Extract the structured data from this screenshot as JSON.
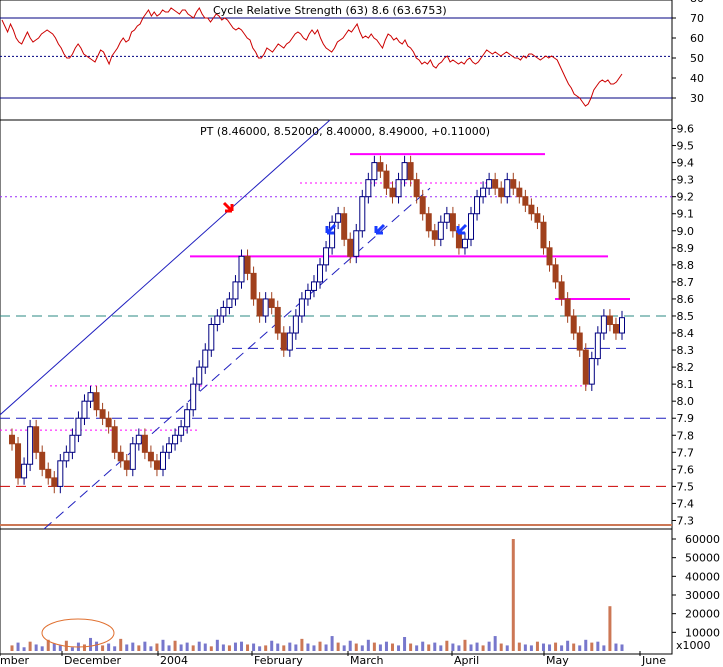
{
  "chart_data": [
    {
      "type": "line",
      "panel": "indicator",
      "title": "Cycle Relative Strength (63) 8.6 (63.6753)",
      "ylim": [
        20,
        80
      ],
      "y_ticks": [
        30,
        40,
        50,
        60,
        70,
        80
      ],
      "reference_lines": [
        {
          "value": 70,
          "color": "#000080",
          "style": "solid"
        },
        {
          "value": 50.8,
          "color": "#000080",
          "style": "dotted"
        },
        {
          "value": 30,
          "color": "#000080",
          "style": "solid"
        }
      ],
      "series": [
        {
          "color": "#cc0000",
          "values": [
            69,
            66,
            63,
            67,
            64,
            60,
            58,
            57,
            60,
            63,
            60,
            58,
            59,
            60,
            62,
            63,
            64,
            63,
            62,
            60,
            57,
            55,
            52,
            50,
            50,
            52,
            55,
            57,
            55,
            52,
            51,
            50,
            49,
            48,
            51,
            54,
            53,
            50,
            47,
            51,
            53,
            55,
            58,
            60,
            58,
            59,
            63,
            64,
            66,
            67,
            70,
            72,
            74,
            71,
            73,
            71,
            72,
            74,
            73,
            73,
            75,
            74,
            73,
            72,
            74,
            74,
            72,
            71,
            70,
            73,
            75,
            72,
            70,
            70,
            68,
            70,
            72,
            71,
            69,
            70,
            69,
            67,
            65,
            64,
            65,
            64,
            62,
            60,
            59,
            55,
            53,
            50,
            50,
            52,
            55,
            54,
            53,
            55,
            57,
            56,
            55,
            57,
            58,
            60,
            62,
            63,
            62,
            60,
            59,
            62,
            64,
            62,
            64,
            60,
            57,
            55,
            54,
            53,
            55,
            58,
            59,
            60,
            62,
            64,
            63,
            65,
            67,
            63,
            60,
            61,
            60,
            62,
            60,
            59,
            57,
            55,
            59,
            62,
            61,
            59,
            60,
            58,
            57,
            59,
            56,
            55,
            53,
            50,
            49,
            47,
            48,
            47,
            49,
            46,
            45,
            47,
            48,
            50,
            51,
            48,
            49,
            48,
            47,
            48,
            47,
            49,
            50,
            48,
            47,
            48,
            50,
            52,
            54,
            53,
            52,
            53,
            52,
            51,
            52,
            53,
            52,
            51,
            50,
            50,
            49,
            51,
            50,
            52,
            52,
            51,
            50,
            49,
            50,
            51,
            50,
            51,
            50,
            49,
            46,
            43,
            40,
            37,
            35,
            32,
            31,
            30,
            28,
            26,
            27,
            30,
            34,
            36,
            38,
            39,
            38,
            39,
            37,
            37,
            38,
            40,
            42
          ]
        }
      ],
      "last_value": 63.6753
    },
    {
      "type": "candlestick",
      "panel": "price",
      "title": "PT (8.46000, 8.52000, 8.40000, 8.49000, +0.11000)",
      "ylim": [
        7.25,
        9.65
      ],
      "y_ticks": [
        7.3,
        7.4,
        7.5,
        7.6,
        7.7,
        7.8,
        7.9,
        8.0,
        8.1,
        8.2,
        8.3,
        8.4,
        8.5,
        8.6,
        8.7,
        8.8,
        8.9,
        9.0,
        9.1,
        9.2,
        9.3,
        9.4,
        9.5,
        9.6
      ],
      "ohlc": {
        "open": 8.46,
        "high": 8.52,
        "low": 8.4,
        "close": 8.49,
        "change": 0.11
      },
      "close_values": [
        7.75,
        7.55,
        7.63,
        7.85,
        7.7,
        7.6,
        7.55,
        7.5,
        7.65,
        7.7,
        7.8,
        7.9,
        8.0,
        8.05,
        7.95,
        7.9,
        7.85,
        7.7,
        7.65,
        7.6,
        7.75,
        7.8,
        7.7,
        7.65,
        7.6,
        7.7,
        7.75,
        7.8,
        7.85,
        7.95,
        8.1,
        8.2,
        8.3,
        8.45,
        8.5,
        8.55,
        8.6,
        8.7,
        8.85,
        8.75,
        8.6,
        8.5,
        8.6,
        8.55,
        8.4,
        8.3,
        8.4,
        8.5,
        8.6,
        8.65,
        8.7,
        8.8,
        8.9,
        9.05,
        9.1,
        8.95,
        8.85,
        9.0,
        9.2,
        9.3,
        9.4,
        9.35,
        9.25,
        9.2,
        9.3,
        9.4,
        9.3,
        9.2,
        9.1,
        9.0,
        8.95,
        9.05,
        9.1,
        9.0,
        8.9,
        8.95,
        9.1,
        9.2,
        9.25,
        9.3,
        9.25,
        9.2,
        9.3,
        9.25,
        9.2,
        9.15,
        9.1,
        9.05,
        8.9,
        8.8,
        8.7,
        8.6,
        8.5,
        8.4,
        8.3,
        8.1,
        8.25,
        8.4,
        8.5,
        8.45,
        8.4,
        8.49
      ],
      "reference_lines": [
        {
          "value": 9.45,
          "color": "#ff00ff",
          "style": "solid"
        },
        {
          "value": 9.2,
          "color": "#9a2cfa",
          "style": "dotted"
        },
        {
          "value": 8.85,
          "color": "#ff00ff",
          "style": "solid"
        },
        {
          "value": 8.6,
          "color": "#ff00ff",
          "style": "solid"
        },
        {
          "value": 8.5,
          "color": "#2b8a83",
          "style": "dashed"
        },
        {
          "value": 8.31,
          "color": "#1f1fbf",
          "style": "dashed"
        },
        {
          "value": 8.09,
          "color": "#ff00ff",
          "style": "dotted"
        },
        {
          "value": 7.9,
          "color": "#1f1fbf",
          "style": "dashed"
        },
        {
          "value": 7.5,
          "color": "#cc0000",
          "style": "dashed"
        }
      ]
    },
    {
      "type": "bar",
      "panel": "volume",
      "ylim": [
        0,
        60000
      ],
      "y_ticks": [
        10000,
        20000,
        30000,
        40000,
        50000,
        60000
      ],
      "multiplier_label": "x1000",
      "values": [
        3000,
        4500,
        2000,
        5000,
        3500,
        2500,
        6000,
        4000,
        3000,
        5500,
        2000,
        4500,
        3500,
        7000,
        5000,
        3000,
        4000,
        2500,
        6500,
        3500,
        4500,
        3000,
        5000,
        2500,
        4000,
        6000,
        3000,
        5500,
        3500,
        4500,
        3000,
        5000,
        4000,
        2500,
        6000,
        3500,
        3000,
        4500,
        5000,
        3500,
        4000,
        2500,
        3000,
        5500,
        4000,
        3000,
        4500,
        3500,
        6500,
        4000,
        3000,
        5000,
        3500,
        8000,
        4500,
        3000,
        5500,
        4000,
        3000,
        6000,
        4500,
        3500,
        5000,
        4000,
        3000,
        7500,
        4000,
        3000,
        5000,
        3500,
        4500,
        3000,
        5500,
        4000,
        3000,
        6000,
        3500,
        4500,
        3000,
        5000,
        8000,
        4000,
        3000,
        60000,
        4500,
        3500,
        3000,
        5000,
        4000,
        3500,
        4500,
        3000,
        5500,
        4000,
        3000,
        6000,
        4500,
        5000,
        3000,
        24000,
        4000,
        3500
      ],
      "colors": {
        "up": "#7777cc",
        "down": "#cc7755",
        "spike": "#cc7755"
      }
    }
  ],
  "x_axis": {
    "labels": [
      "mber",
      "December",
      "2004",
      "February",
      "March",
      "April",
      "May",
      "June"
    ]
  },
  "colors": {
    "up_candle": "#ffffff",
    "up_candle_border": "#000080",
    "down_candle": "#a0401c",
    "rs_line": "#cc0000",
    "trend_lines": "#1f1fbf",
    "arrow_red": "#ff0000",
    "arrow_blue": "#1a3cff"
  }
}
